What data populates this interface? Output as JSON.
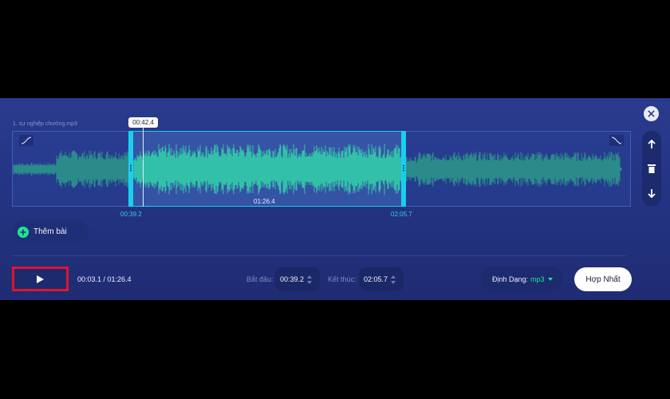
{
  "track": {
    "file_name": "1. sự nghiệp chướng.mp3",
    "playhead_time": "00:42.4",
    "selection_duration": "01:26.4",
    "selection_start": "00:39.2",
    "selection_end": "02:05.7"
  },
  "add_track": {
    "label": "Thêm bài"
  },
  "player": {
    "time_position": "00:03.1 / 01:26.4"
  },
  "start_field": {
    "label": "Bắt đầu:",
    "value": "00:39.2"
  },
  "end_field": {
    "label": "Kết thúc:",
    "value": "02:05.7"
  },
  "format": {
    "label": "Định Dạng:",
    "value": "mp3"
  },
  "merge_button": {
    "label": "Hợp Nhất"
  },
  "colors": {
    "panel_bg": "#2a3a8e",
    "accent_cyan": "#19cfee",
    "wave_selected": "#22e392",
    "wave_unselected": "#2b8a8a",
    "highlight_box": "#e0142e"
  },
  "icons": {
    "close": "close-icon",
    "fade_in": "fade-in-icon",
    "fade_out": "fade-out-icon",
    "move_up": "arrow-up-icon",
    "delete": "trash-icon",
    "move_down": "arrow-down-icon",
    "add": "plus-icon",
    "play": "play-icon",
    "dropdown": "chevron-down-icon"
  }
}
